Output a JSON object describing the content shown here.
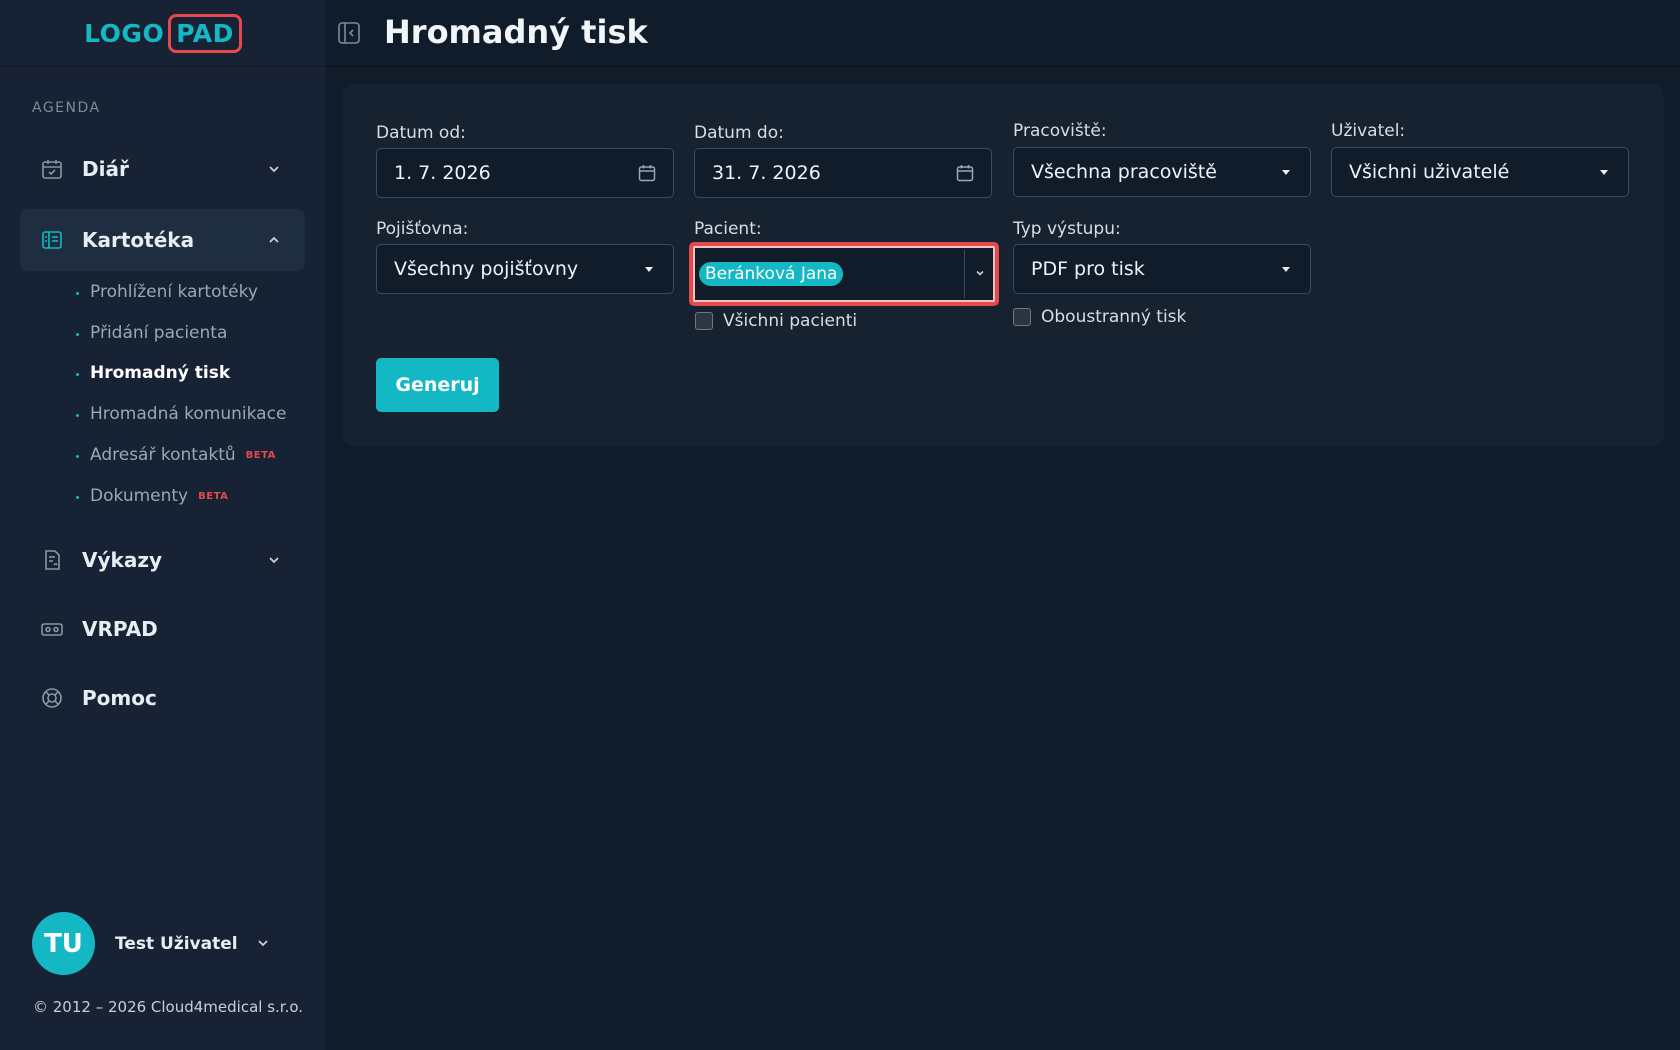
{
  "logo": {
    "left": "LOGO",
    "right": "PAD"
  },
  "sidebar": {
    "section_label": "AGENDA",
    "items": [
      {
        "label": "Diář",
        "icon": "calendar-check-icon"
      },
      {
        "label": "Kartotéka",
        "icon": "card-index-icon"
      },
      {
        "label": "Výkazy",
        "icon": "report-icon"
      },
      {
        "label": "VRPAD",
        "icon": "vr-headset-icon"
      },
      {
        "label": "Pomoc",
        "icon": "lifebuoy-icon"
      }
    ],
    "sub_items": [
      {
        "label": "Prohlížení kartotéky"
      },
      {
        "label": "Přidání pacienta"
      },
      {
        "label": "Hromadný tisk"
      },
      {
        "label": "Hromadná komunikace"
      },
      {
        "label": "Adresář kontaktů",
        "badge": "BETA"
      },
      {
        "label": "Dokumenty",
        "badge": "BETA"
      }
    ]
  },
  "user": {
    "initials": "TU",
    "name": "Test Uživatel"
  },
  "footer": {
    "copyright": "© 2012 – 2026 Cloud4medical s.r.o."
  },
  "header": {
    "title": "Hromadný tisk"
  },
  "form": {
    "date_from": {
      "label": "Datum od:",
      "value": "1. 7. 2026"
    },
    "date_to": {
      "label": "Datum do:",
      "value": "31. 7. 2026"
    },
    "workplace": {
      "label": "Pracoviště:",
      "value": "Všechna pracoviště"
    },
    "user": {
      "label": "Uživatel:",
      "value": "Všichni uživatelé"
    },
    "insurance": {
      "label": "Pojišťovna:",
      "value": "Všechny pojišťovny"
    },
    "patient": {
      "label": "Pacient:",
      "chip": "Beránková Jana"
    },
    "all_patients": {
      "label": "Všichni pacienti",
      "checked": false
    },
    "output_type": {
      "label": "Typ výstupu:",
      "value": "PDF pro tisk"
    },
    "duplex": {
      "label": "Oboustranný tisk",
      "checked": false
    },
    "generate_label": "Generuj"
  },
  "colors": {
    "accent": "#14b8c4",
    "highlight": "#e5484d",
    "beta": "#e5484d"
  }
}
